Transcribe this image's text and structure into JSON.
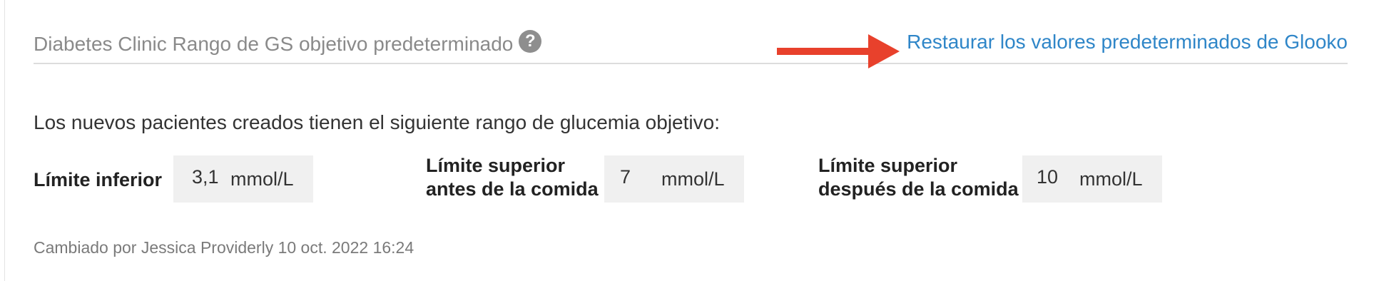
{
  "header": {
    "title": "Diabetes Clinic Rango de GS objetivo predeterminado",
    "help_icon": "question-circle-icon",
    "restore_link": "Restaurar los valores predeterminados de Glooko",
    "arrow_color": "#e8412c",
    "link_color": "#2f86c8"
  },
  "intro_text": "Los nuevos pacientes creados tienen el siguiente rango de glucemia objetivo:",
  "fields": [
    {
      "label": "Límite inferior",
      "value": "3,1",
      "unit": "mmol/L"
    },
    {
      "label_line1": "Límite superior",
      "label_line2": "antes de la comida",
      "value": "7",
      "unit": "mmol/L"
    },
    {
      "label_line1": "Límite superior",
      "label_line2": "después de la comida",
      "value": "10",
      "unit": "mmol/L"
    }
  ],
  "changed_by": "Cambiado por Jessica Providerly 10 oct. 2022 16:24"
}
